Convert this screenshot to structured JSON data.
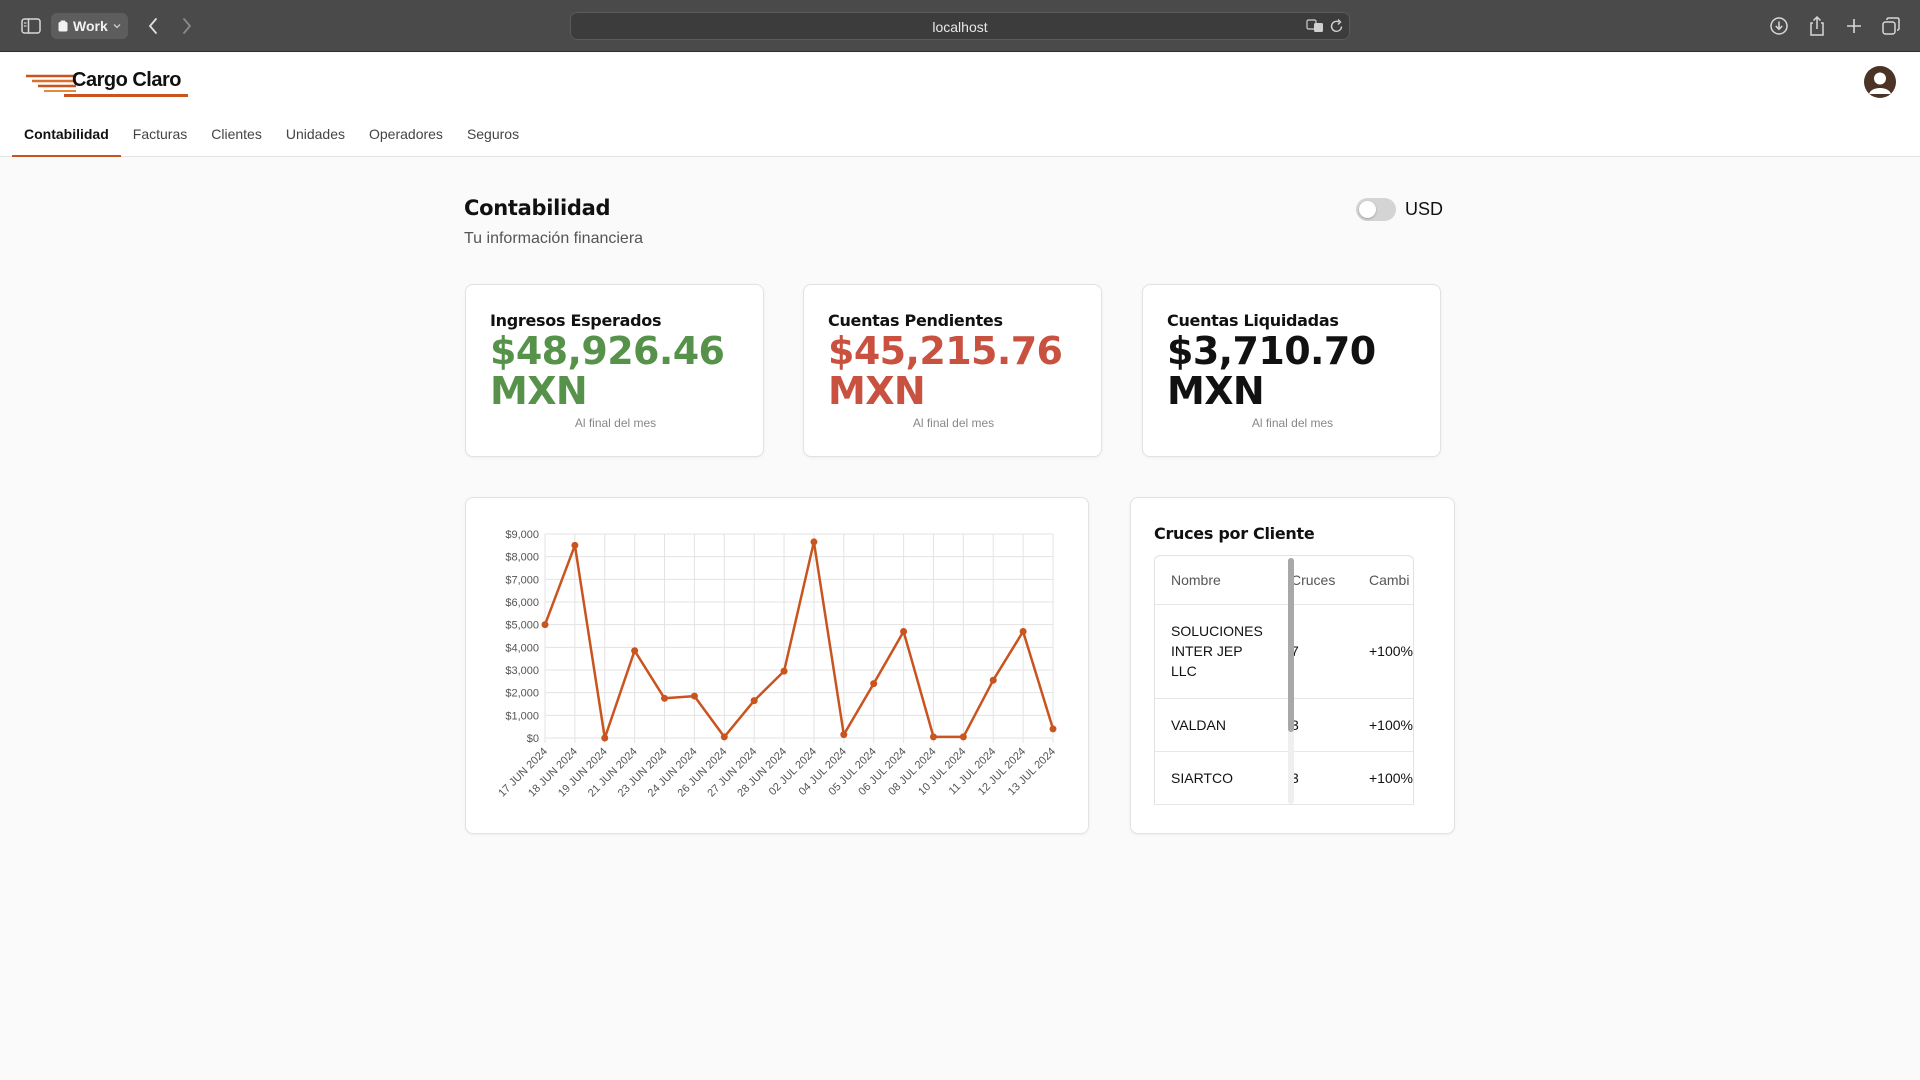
{
  "browser": {
    "tab_group": "Work",
    "url": "localhost"
  },
  "app": {
    "brand": "Cargo Claro",
    "accent_color": "#c9541f",
    "nav": [
      {
        "label": "Contabilidad",
        "active": true
      },
      {
        "label": "Facturas",
        "active": false
      },
      {
        "label": "Clientes",
        "active": false
      },
      {
        "label": "Unidades",
        "active": false
      },
      {
        "label": "Operadores",
        "active": false
      },
      {
        "label": "Seguros",
        "active": false
      }
    ]
  },
  "page": {
    "title": "Contabilidad",
    "subtitle": "Tu información financiera",
    "currency_toggle": {
      "label": "USD",
      "on": false
    }
  },
  "stats": [
    {
      "label": "Ingresos Esperados",
      "value": "$48,926.46 MXN",
      "caption": "Al final del mes",
      "color": "#56924a"
    },
    {
      "label": "Cuentas Pendientes",
      "value": "$45,215.76 MXN",
      "caption": "Al final del mes",
      "color": "#c8513f"
    },
    {
      "label": "Cuentas Liquidadas",
      "value": "$3,710.70 MXN",
      "caption": "Al final del mes",
      "color": "#111111"
    }
  ],
  "chart_data": {
    "type": "line",
    "title": "",
    "xlabel": "",
    "ylabel": "",
    "x": [
      "17 JUN 2024",
      "18 JUN 2024",
      "19 JUN 2024",
      "21 JUN 2024",
      "23 JUN 2024",
      "24 JUN 2024",
      "26 JUN 2024",
      "27 JUN 2024",
      "28 JUN 2024",
      "02 JUL 2024",
      "04 JUL 2024",
      "05 JUL 2024",
      "06 JUL 2024",
      "08 JUL 2024",
      "10 JUL 2024",
      "11 JUL 2024",
      "12 JUL 2024",
      "13 JUL 2024"
    ],
    "series": [
      {
        "values": [
          5000,
          8500,
          0,
          3850,
          1750,
          1850,
          50,
          1650,
          2950,
          8650,
          150,
          2400,
          4700,
          50,
          50,
          2550,
          4700,
          400
        ],
        "color": "#c9541f"
      }
    ],
    "ylim": [
      0,
      9000
    ],
    "yticks": [
      "$0",
      "$1,000",
      "$2,000",
      "$3,000",
      "$4,000",
      "$5,000",
      "$6,000",
      "$7,000",
      "$8,000",
      "$9,000"
    ],
    "grid": true
  },
  "cruces": {
    "title": "Cruces por Cliente",
    "headers": [
      "Nombre",
      "Cruces",
      "Cambi"
    ],
    "rows": [
      {
        "name": "SOLUCIONES INTER JEP LLC",
        "cruces": "7",
        "cambio": "+100%"
      },
      {
        "name": "VALDAN",
        "cruces": "3",
        "cambio": "+100%"
      },
      {
        "name": "SIARTCO",
        "cruces": "3",
        "cambio": "+100%"
      }
    ]
  }
}
